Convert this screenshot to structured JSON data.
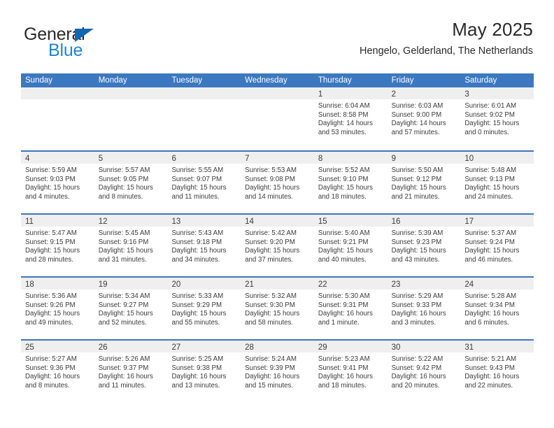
{
  "logo": {
    "word_primary": "General",
    "word_secondary": "Blue",
    "primary_color": "#2a2a2a",
    "secondary_color": "#1f84d6",
    "triangle_color": "#1267b2"
  },
  "header": {
    "title": "May 2025",
    "subtitle": "Hengelo, Gelderland, The Netherlands"
  },
  "theme": {
    "header_bar": "#3b78c0",
    "day_band": "#efefef",
    "text": "#3c3c3c",
    "background": "#ffffff"
  },
  "weekdays": [
    "Sunday",
    "Monday",
    "Tuesday",
    "Wednesday",
    "Thursday",
    "Friday",
    "Saturday"
  ],
  "weeks": [
    [
      {
        "day": "",
        "lines": []
      },
      {
        "day": "",
        "lines": []
      },
      {
        "day": "",
        "lines": []
      },
      {
        "day": "",
        "lines": []
      },
      {
        "day": "1",
        "lines": [
          "Sunrise: 6:04 AM",
          "Sunset: 8:58 PM",
          "Daylight: 14 hours",
          "and 53 minutes."
        ]
      },
      {
        "day": "2",
        "lines": [
          "Sunrise: 6:03 AM",
          "Sunset: 9:00 PM",
          "Daylight: 14 hours",
          "and 57 minutes."
        ]
      },
      {
        "day": "3",
        "lines": [
          "Sunrise: 6:01 AM",
          "Sunset: 9:02 PM",
          "Daylight: 15 hours",
          "and 0 minutes."
        ]
      }
    ],
    [
      {
        "day": "4",
        "lines": [
          "Sunrise: 5:59 AM",
          "Sunset: 9:03 PM",
          "Daylight: 15 hours",
          "and 4 minutes."
        ]
      },
      {
        "day": "5",
        "lines": [
          "Sunrise: 5:57 AM",
          "Sunset: 9:05 PM",
          "Daylight: 15 hours",
          "and 8 minutes."
        ]
      },
      {
        "day": "6",
        "lines": [
          "Sunrise: 5:55 AM",
          "Sunset: 9:07 PM",
          "Daylight: 15 hours",
          "and 11 minutes."
        ]
      },
      {
        "day": "7",
        "lines": [
          "Sunrise: 5:53 AM",
          "Sunset: 9:08 PM",
          "Daylight: 15 hours",
          "and 14 minutes."
        ]
      },
      {
        "day": "8",
        "lines": [
          "Sunrise: 5:52 AM",
          "Sunset: 9:10 PM",
          "Daylight: 15 hours",
          "and 18 minutes."
        ]
      },
      {
        "day": "9",
        "lines": [
          "Sunrise: 5:50 AM",
          "Sunset: 9:12 PM",
          "Daylight: 15 hours",
          "and 21 minutes."
        ]
      },
      {
        "day": "10",
        "lines": [
          "Sunrise: 5:48 AM",
          "Sunset: 9:13 PM",
          "Daylight: 15 hours",
          "and 24 minutes."
        ]
      }
    ],
    [
      {
        "day": "11",
        "lines": [
          "Sunrise: 5:47 AM",
          "Sunset: 9:15 PM",
          "Daylight: 15 hours",
          "and 28 minutes."
        ]
      },
      {
        "day": "12",
        "lines": [
          "Sunrise: 5:45 AM",
          "Sunset: 9:16 PM",
          "Daylight: 15 hours",
          "and 31 minutes."
        ]
      },
      {
        "day": "13",
        "lines": [
          "Sunrise: 5:43 AM",
          "Sunset: 9:18 PM",
          "Daylight: 15 hours",
          "and 34 minutes."
        ]
      },
      {
        "day": "14",
        "lines": [
          "Sunrise: 5:42 AM",
          "Sunset: 9:20 PM",
          "Daylight: 15 hours",
          "and 37 minutes."
        ]
      },
      {
        "day": "15",
        "lines": [
          "Sunrise: 5:40 AM",
          "Sunset: 9:21 PM",
          "Daylight: 15 hours",
          "and 40 minutes."
        ]
      },
      {
        "day": "16",
        "lines": [
          "Sunrise: 5:39 AM",
          "Sunset: 9:23 PM",
          "Daylight: 15 hours",
          "and 43 minutes."
        ]
      },
      {
        "day": "17",
        "lines": [
          "Sunrise: 5:37 AM",
          "Sunset: 9:24 PM",
          "Daylight: 15 hours",
          "and 46 minutes."
        ]
      }
    ],
    [
      {
        "day": "18",
        "lines": [
          "Sunrise: 5:36 AM",
          "Sunset: 9:26 PM",
          "Daylight: 15 hours",
          "and 49 minutes."
        ]
      },
      {
        "day": "19",
        "lines": [
          "Sunrise: 5:34 AM",
          "Sunset: 9:27 PM",
          "Daylight: 15 hours",
          "and 52 minutes."
        ]
      },
      {
        "day": "20",
        "lines": [
          "Sunrise: 5:33 AM",
          "Sunset: 9:29 PM",
          "Daylight: 15 hours",
          "and 55 minutes."
        ]
      },
      {
        "day": "21",
        "lines": [
          "Sunrise: 5:32 AM",
          "Sunset: 9:30 PM",
          "Daylight: 15 hours",
          "and 58 minutes."
        ]
      },
      {
        "day": "22",
        "lines": [
          "Sunrise: 5:30 AM",
          "Sunset: 9:31 PM",
          "Daylight: 16 hours",
          "and 1 minute."
        ]
      },
      {
        "day": "23",
        "lines": [
          "Sunrise: 5:29 AM",
          "Sunset: 9:33 PM",
          "Daylight: 16 hours",
          "and 3 minutes."
        ]
      },
      {
        "day": "24",
        "lines": [
          "Sunrise: 5:28 AM",
          "Sunset: 9:34 PM",
          "Daylight: 16 hours",
          "and 6 minutes."
        ]
      }
    ],
    [
      {
        "day": "25",
        "lines": [
          "Sunrise: 5:27 AM",
          "Sunset: 9:36 PM",
          "Daylight: 16 hours",
          "and 8 minutes."
        ]
      },
      {
        "day": "26",
        "lines": [
          "Sunrise: 5:26 AM",
          "Sunset: 9:37 PM",
          "Daylight: 16 hours",
          "and 11 minutes."
        ]
      },
      {
        "day": "27",
        "lines": [
          "Sunrise: 5:25 AM",
          "Sunset: 9:38 PM",
          "Daylight: 16 hours",
          "and 13 minutes."
        ]
      },
      {
        "day": "28",
        "lines": [
          "Sunrise: 5:24 AM",
          "Sunset: 9:39 PM",
          "Daylight: 16 hours",
          "and 15 minutes."
        ]
      },
      {
        "day": "29",
        "lines": [
          "Sunrise: 5:23 AM",
          "Sunset: 9:41 PM",
          "Daylight: 16 hours",
          "and 18 minutes."
        ]
      },
      {
        "day": "30",
        "lines": [
          "Sunrise: 5:22 AM",
          "Sunset: 9:42 PM",
          "Daylight: 16 hours",
          "and 20 minutes."
        ]
      },
      {
        "day": "31",
        "lines": [
          "Sunrise: 5:21 AM",
          "Sunset: 9:43 PM",
          "Daylight: 16 hours",
          "and 22 minutes."
        ]
      }
    ]
  ]
}
